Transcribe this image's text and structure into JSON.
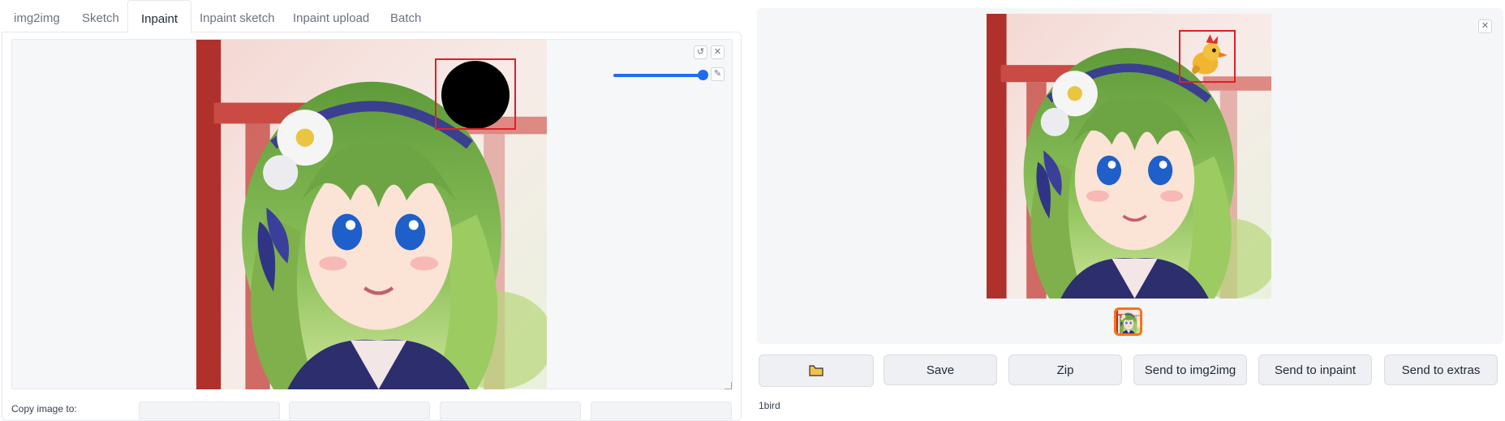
{
  "tabs": [
    {
      "label": "img2img",
      "active": false
    },
    {
      "label": "Sketch",
      "active": false
    },
    {
      "label": "Inpaint",
      "active": true
    },
    {
      "label": "Inpaint sketch",
      "active": false
    },
    {
      "label": "Inpaint upload",
      "active": false
    },
    {
      "label": "Batch",
      "active": false
    }
  ],
  "canvas": {
    "undo_icon": "undo-icon",
    "clear_icon": "close-icon",
    "brush_icon": "brush-icon",
    "brush_size_fraction": 0.95,
    "brush_color": "#1d6cf2",
    "mask_color": "#000000"
  },
  "copy_image": {
    "label": "Copy image to:"
  },
  "gallery": {
    "close_icon": "close-icon",
    "selected_border_color": "#f97316",
    "highlight_color": "#e01f26"
  },
  "actions": {
    "folder_icon": "folder-icon",
    "save": "Save",
    "zip": "Zip",
    "send_img2img": "Send to img2img",
    "send_inpaint": "Send to inpaint",
    "send_extras": "Send to extras"
  },
  "generation_info": "1bird"
}
